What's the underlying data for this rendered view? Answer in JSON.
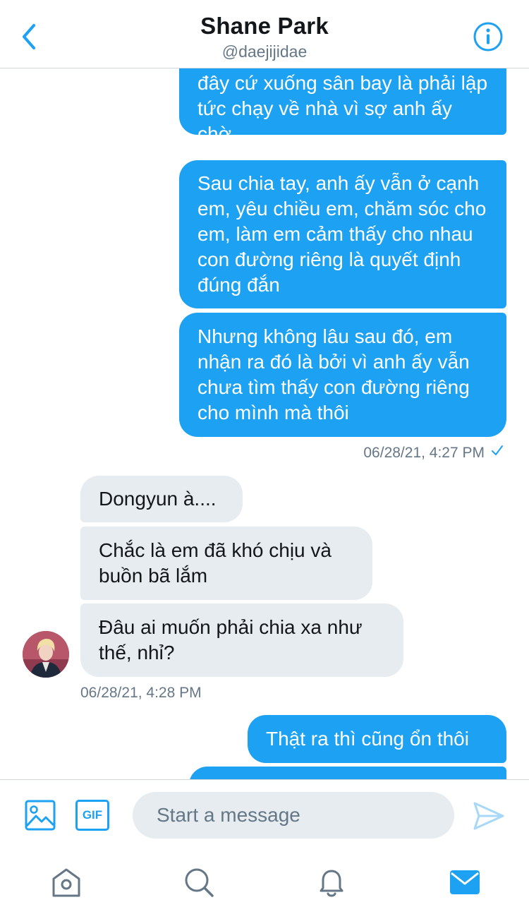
{
  "header": {
    "title": "Shane Park",
    "handle": "@daejijidae"
  },
  "messages": {
    "out_1": "đây cứ xuống sân bay là phải lập tức chạy về nhà vì sợ anh ấy chờ",
    "out_2": "Sau chia tay, anh ấy vẫn ở cạnh em, yêu chiều em, chăm sóc cho em, làm em cảm thấy cho nhau con đường riêng là quyết định đúng đắn",
    "out_3": "Nhưng không lâu sau đó, em nhận ra đó là bởi vì anh ấy vẫn chưa tìm thấy con đường riêng cho mình mà thôi",
    "timestamp_out": "06/28/21, 4:27 PM",
    "in_1": "Dongyun à....",
    "in_2": "Chắc là em đã khó chịu và buồn bã lắm",
    "in_3": "Đâu ai muốn phải chia xa như thế, nhỉ?",
    "timestamp_in": "06/28/21, 4:28 PM",
    "out_4": "Thật ra thì cũng ổn thôi",
    "out_5": ""
  },
  "composer": {
    "placeholder": "Start a message",
    "gif_label": "GIF"
  },
  "icons": {
    "back": "chevron-left-icon",
    "info": "info-icon",
    "media": "image-icon",
    "send": "send-icon",
    "home": "home-icon",
    "search": "search-icon",
    "notifications": "bell-icon",
    "messages": "envelope-icon"
  },
  "colors": {
    "accent": "#1da1f2",
    "incoming_bubble": "#e6ecf0",
    "secondary_text": "#657786"
  }
}
